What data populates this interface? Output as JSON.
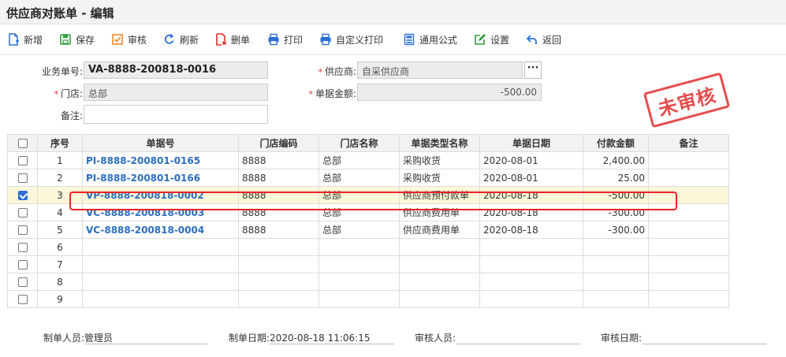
{
  "title": "供应商对账单 - 编辑",
  "toolbar": {
    "new": "新增",
    "save": "保存",
    "audit": "审核",
    "refresh": "刷新",
    "delete": "删单",
    "print": "打印",
    "custom_print": "自定义打印",
    "formula": "通用公式",
    "settings": "设置",
    "back": "返回",
    "icons": [
      "new-file-icon",
      "save-icon",
      "audit-check-icon",
      "refresh-icon",
      "delete-doc-icon",
      "printer-icon",
      "custom-printer-icon",
      "calculator-icon",
      "settings-edit-icon",
      "back-arrow-icon"
    ],
    "accent": "#2b6fd6",
    "colors": {
      "new": "#2b6fd6",
      "save": "#2e9e3e",
      "audit": "#f08a24",
      "refresh": "#2b6fd6",
      "delete": "#d93025",
      "print": "#2b6fd6",
      "custom_print": "#2b6fd6",
      "formula": "#2b6fd6",
      "settings": "#2e9e3e",
      "back": "#2b6fd6"
    }
  },
  "form": {
    "bill_no_label": "业务单号:",
    "bill_no": "VA-8888-200818-0016",
    "supplier_label": "供应商:",
    "supplier": "自采供应商",
    "store_label": "门店:",
    "store": "总部",
    "amount_label": "单据金额:",
    "amount": "-500.00",
    "remark_label": "备注:",
    "remark": "",
    "required_mark": "*"
  },
  "stamp": "未审核",
  "stamp_color": "#e33a3a",
  "table": {
    "headers": [
      "",
      "序号",
      "单据号",
      "门店编码",
      "门店名称",
      "单据类型名称",
      "单据日期",
      "付款金额",
      "备注"
    ],
    "rows": [
      {
        "checked": false,
        "no": "1",
        "doc": "PI-8888-200801-0165",
        "store_code": "8888",
        "store_name": "总部",
        "type": "采购收货",
        "date": "2020-08-01",
        "amount": "2,400.00",
        "remark": ""
      },
      {
        "checked": false,
        "no": "2",
        "doc": "PI-8888-200801-0166",
        "store_code": "8888",
        "store_name": "总部",
        "type": "采购收货",
        "date": "2020-08-01",
        "amount": "25.00",
        "remark": ""
      },
      {
        "checked": true,
        "no": "3",
        "doc": "VP-8888-200818-0002",
        "store_code": "8888",
        "store_name": "总部",
        "type": "供应商预付款单",
        "date": "2020-08-18",
        "amount": "-500.00",
        "remark": ""
      },
      {
        "checked": false,
        "no": "4",
        "doc": "VC-8888-200818-0003",
        "store_code": "8888",
        "store_name": "总部",
        "type": "供应商费用单",
        "date": "2020-08-18",
        "amount": "-300.00",
        "remark": ""
      },
      {
        "checked": false,
        "no": "5",
        "doc": "VC-8888-200818-0004",
        "store_code": "8888",
        "store_name": "总部",
        "type": "供应商费用单",
        "date": "2020-08-18",
        "amount": "-300.00",
        "remark": ""
      },
      {
        "checked": false,
        "no": "6",
        "doc": "",
        "store_code": "",
        "store_name": "",
        "type": "",
        "date": "",
        "amount": "",
        "remark": ""
      },
      {
        "checked": false,
        "no": "7",
        "doc": "",
        "store_code": "",
        "store_name": "",
        "type": "",
        "date": "",
        "amount": "",
        "remark": ""
      },
      {
        "checked": false,
        "no": "8",
        "doc": "",
        "store_code": "",
        "store_name": "",
        "type": "",
        "date": "",
        "amount": "",
        "remark": ""
      },
      {
        "checked": false,
        "no": "9",
        "doc": "",
        "store_code": "",
        "store_name": "",
        "type": "",
        "date": "",
        "amount": "",
        "remark": ""
      }
    ]
  },
  "footer": {
    "maker_label": "制单人员:",
    "maker": "管理员",
    "make_date_label": "制单日期:",
    "make_date": "2020-08-18 11:06:15",
    "auditor_label": "审核人员:",
    "auditor": "",
    "audit_date_label": "审核日期:",
    "audit_date": ""
  }
}
